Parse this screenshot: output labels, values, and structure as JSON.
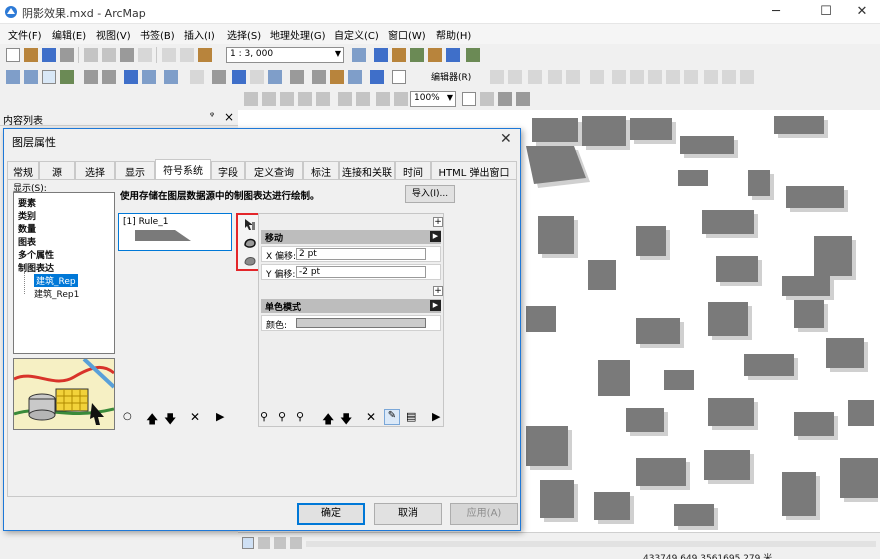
{
  "window": {
    "title": "阴影效果.mxd - ArcMap",
    "minimize": "─",
    "maximize": "☐",
    "close": "✕"
  },
  "menu": [
    "文件(F)",
    "编辑(E)",
    "视图(V)",
    "书签(B)",
    "插入(I)",
    "选择(S)",
    "地理处理(G)",
    "自定义(C)",
    "窗口(W)",
    "帮助(H)"
  ],
  "toolbar": {
    "scale": "1 : 3, 000",
    "editor_label": "编辑器(R)",
    "zoom_percent": "100%"
  },
  "toc": {
    "title": "内容列表",
    "pin": "ᵠ",
    "close": "×"
  },
  "dialog": {
    "title": "图层属性",
    "close": "✕",
    "tabs": [
      "常规",
      "源",
      "选择",
      "显示",
      "符号系统",
      "字段",
      "定义查询",
      "标注",
      "连接和关联",
      "时间",
      "HTML 弹出窗口"
    ],
    "active_tab": 4,
    "show_label": "显示(S):",
    "show_tree": [
      "要素",
      "类别",
      "数量",
      "图表",
      "多个属性",
      "制图表达",
      "建筑_Rep",
      "建筑_Rep1"
    ],
    "selected_item": "建筑_Rep",
    "description": "使用存储在图层数据源中的制图表达进行绘制。",
    "import_button": "导入(I)...",
    "rule": "[1] Rule_1",
    "sections": {
      "move": {
        "title": "移动",
        "x_label": "X 偏移:",
        "x_value": "2 pt",
        "y_label": "Y 偏移:",
        "y_value": "-2 pt"
      },
      "mono": {
        "title": "单色模式",
        "color_label": "颜色:",
        "color": "#cccccc"
      }
    },
    "buttons": {
      "ok": "确定",
      "cancel": "取消",
      "apply": "应用(A)"
    }
  },
  "status": {
    "coordinates": "433749.649  3561695.279 米"
  },
  "colors": {
    "accent": "#0078d7",
    "highlight_box": "#e3262a",
    "building": "#7a7a7a",
    "building_shadow": "#cfcfcf"
  }
}
